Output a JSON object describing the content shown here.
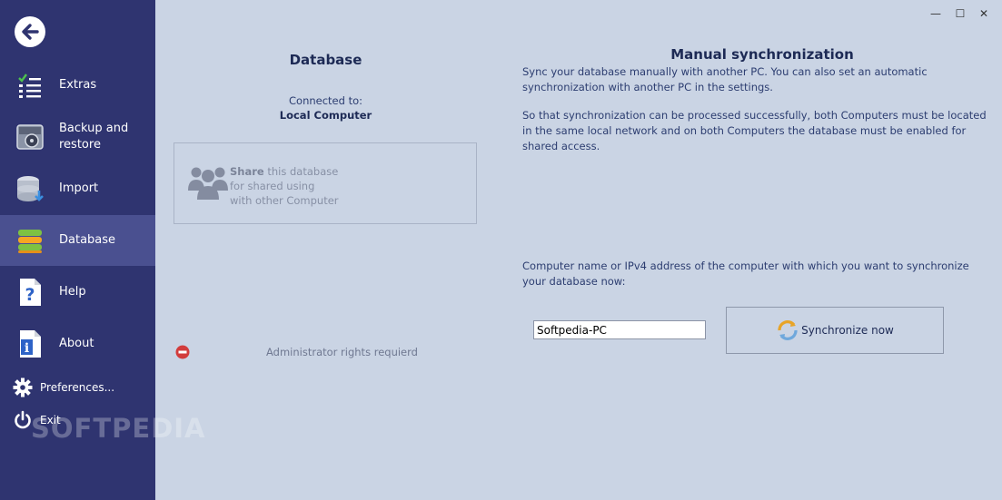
{
  "sidebar": {
    "items": [
      {
        "label": "Extras",
        "icon": "checklist-icon"
      },
      {
        "label": "Backup and\nrestore",
        "icon": "backup-disk-icon"
      },
      {
        "label": "Import",
        "icon": "import-database-icon"
      },
      {
        "label": "Database",
        "icon": "database-icon"
      },
      {
        "label": "Help",
        "icon": "help-document-icon"
      },
      {
        "label": "About",
        "icon": "info-document-icon"
      }
    ],
    "active_item": "Database",
    "preferences_label": "Preferences...",
    "exit_label": "Exit"
  },
  "window": {
    "minimize": "—",
    "maximize": "☐",
    "close": "✕"
  },
  "database_panel": {
    "title": "Database",
    "connected_label": "Connected to:",
    "connected_value": "Local Computer",
    "share_bold": "Share",
    "share_line1": " this database",
    "share_line2": "for shared using",
    "share_line3": "with other Computer",
    "admin_notice": "Administrator rights requierd"
  },
  "sync_panel": {
    "title": "Manual synchronization",
    "description1": "Sync your database manually with another PC. You can also set an automatic synchronization with another PC in the settings.",
    "description2": "So that synchronization can be processed successfully, both Computers must be located in the same local network and on both Computers the database must be enabled for shared access.",
    "computer_label": "Computer name or IPv4 address of the computer with which you want to synchronize your database now:",
    "computer_value": "Softpedia-PC",
    "sync_button": "Synchronize now"
  },
  "watermark": "SOFTPEDIA",
  "colors": {
    "sidebar": "#2f3470",
    "sidebar_active": "#4a5090",
    "main_bg": "#cad4e4",
    "heading": "#1d2a55"
  }
}
